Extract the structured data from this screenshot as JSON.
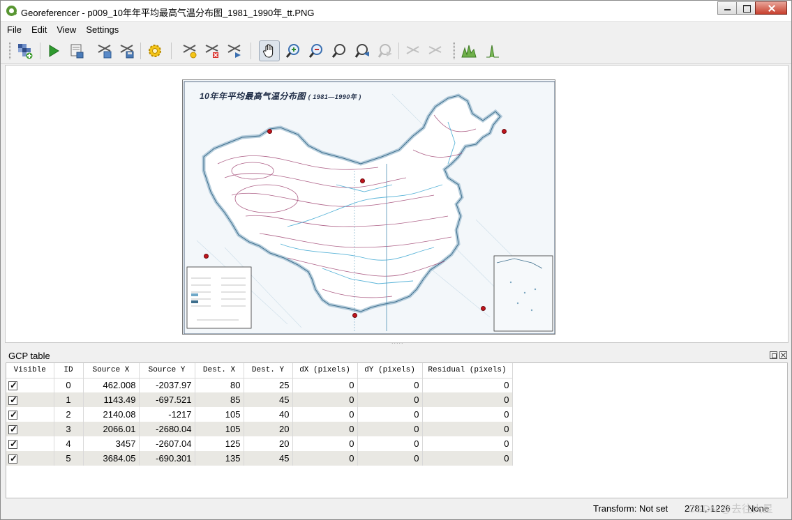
{
  "window": {
    "title": "Georeferencer - p009_10年年平均最高气温分布图_1981_1990年_tt.PNG"
  },
  "menu": [
    "File",
    "Edit",
    "View",
    "Settings"
  ],
  "toolbar": {
    "buttons": [
      {
        "name": "open-raster",
        "icon": "open-raster-icon"
      },
      {
        "name": "start-georeferencing",
        "icon": "play-icon"
      },
      {
        "name": "generate-gdal-script",
        "icon": "gdal-script-icon"
      },
      {
        "name": "load-gcp-points",
        "icon": "load-gcp-icon"
      },
      {
        "name": "save-gcp-points",
        "icon": "save-gcp-icon"
      },
      {
        "name": "transformation-settings",
        "icon": "gear-icon"
      },
      {
        "name": "add-point",
        "icon": "add-point-icon"
      },
      {
        "name": "delete-point",
        "icon": "delete-point-icon"
      },
      {
        "name": "move-gcp-point",
        "icon": "move-point-icon"
      },
      {
        "name": "pan",
        "icon": "pan-hand-icon"
      },
      {
        "name": "zoom-in",
        "icon": "zoom-in-icon"
      },
      {
        "name": "zoom-out",
        "icon": "zoom-out-icon"
      },
      {
        "name": "zoom-to-layer",
        "icon": "zoom-layer-icon"
      },
      {
        "name": "zoom-last",
        "icon": "zoom-last-icon"
      },
      {
        "name": "zoom-next",
        "icon": "zoom-next-icon"
      },
      {
        "name": "link-georeferencer-to-qgis",
        "icon": "link-geo-icon"
      },
      {
        "name": "link-qgis-to-georeferencer",
        "icon": "link-qgis-icon"
      },
      {
        "name": "full-histogram-stretch",
        "icon": "histogram-full-icon"
      },
      {
        "name": "local-histogram-stretch",
        "icon": "histogram-local-icon"
      }
    ]
  },
  "map": {
    "title": "10年年平均最高气温分布图",
    "subtitle": "( 1981—1990年 )"
  },
  "gcp_panel": {
    "title": "GCP table",
    "columns": [
      "Visible",
      "ID",
      "Source X",
      "Source Y",
      "Dest. X",
      "Dest. Y",
      "dX (pixels)",
      "dY (pixels)",
      "Residual (pixels)"
    ],
    "rows": [
      {
        "id": "0",
        "source_x": "462.008",
        "source_y": "-2037.97",
        "dest_x": "80",
        "dest_y": "25",
        "dx": "0",
        "dy": "0",
        "residual": "0"
      },
      {
        "id": "1",
        "source_x": "1143.49",
        "source_y": "-697.521",
        "dest_x": "85",
        "dest_y": "45",
        "dx": "0",
        "dy": "0",
        "residual": "0"
      },
      {
        "id": "2",
        "source_x": "2140.08",
        "source_y": "-1217",
        "dest_x": "105",
        "dest_y": "40",
        "dx": "0",
        "dy": "0",
        "residual": "0"
      },
      {
        "id": "3",
        "source_x": "2066.01",
        "source_y": "-2680.04",
        "dest_x": "105",
        "dest_y": "20",
        "dx": "0",
        "dy": "0",
        "residual": "0"
      },
      {
        "id": "4",
        "source_x": "3457",
        "source_y": "-2607.04",
        "dest_x": "125",
        "dest_y": "20",
        "dx": "0",
        "dy": "0",
        "residual": "0"
      },
      {
        "id": "5",
        "source_x": "3684.05",
        "source_y": "-690.301",
        "dest_x": "135",
        "dest_y": "45",
        "dx": "0",
        "dy": "0",
        "residual": "0"
      }
    ]
  },
  "status": {
    "transform": "Transform: Not set",
    "coordinates": "2781,-1226",
    "crs": "None",
    "watermark": "CSDN @去往火星"
  }
}
